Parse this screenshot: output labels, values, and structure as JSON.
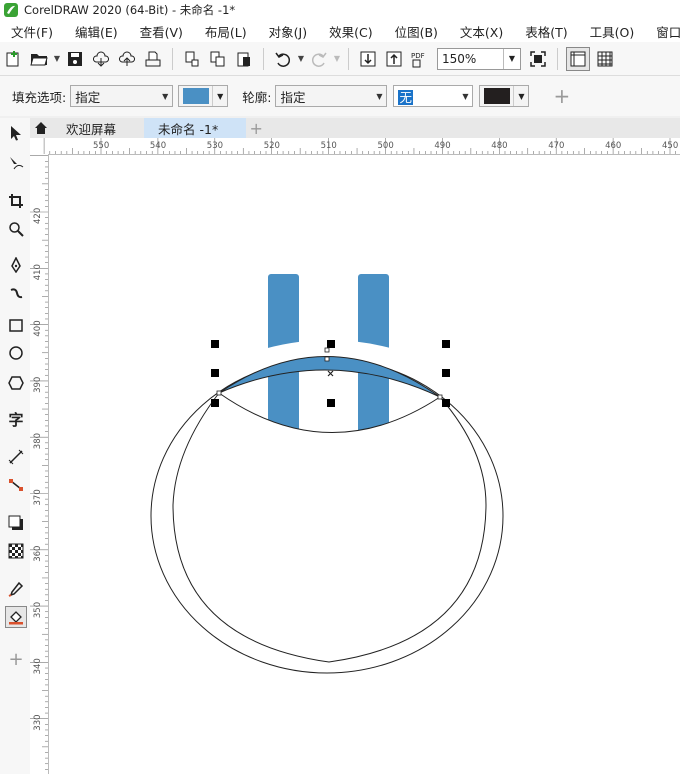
{
  "window": {
    "title": "CorelDRAW 2020 (64-Bit) - 未命名 -1*"
  },
  "menu": [
    "文件(F)",
    "编辑(E)",
    "查看(V)",
    "布局(L)",
    "对象(J)",
    "效果(C)",
    "位图(B)",
    "文本(X)",
    "表格(T)",
    "工具(O)",
    "窗口"
  ],
  "toolbar": {
    "zoom_value": "150%"
  },
  "property_bar": {
    "fill_label": "填充选项:",
    "fill_value": "指定",
    "fill_color": "#4a90c4",
    "outline_label": "轮廓:",
    "outline_value": "指定",
    "outline_width": "无",
    "outline_color": "#231f1f"
  },
  "tabs": {
    "welcome": "欢迎屏幕",
    "document": "未命名 -1*"
  },
  "rulers": {
    "top": [
      "550",
      "540",
      "530",
      "520",
      "510",
      "500",
      "490",
      "480",
      "470",
      "460",
      "450"
    ],
    "left": [
      "420",
      "410",
      "400",
      "390",
      "380",
      "370",
      "360",
      "350",
      "340",
      "330"
    ]
  },
  "artwork": {
    "shape_color": "#4a90c4",
    "outline_color": "#222222"
  }
}
